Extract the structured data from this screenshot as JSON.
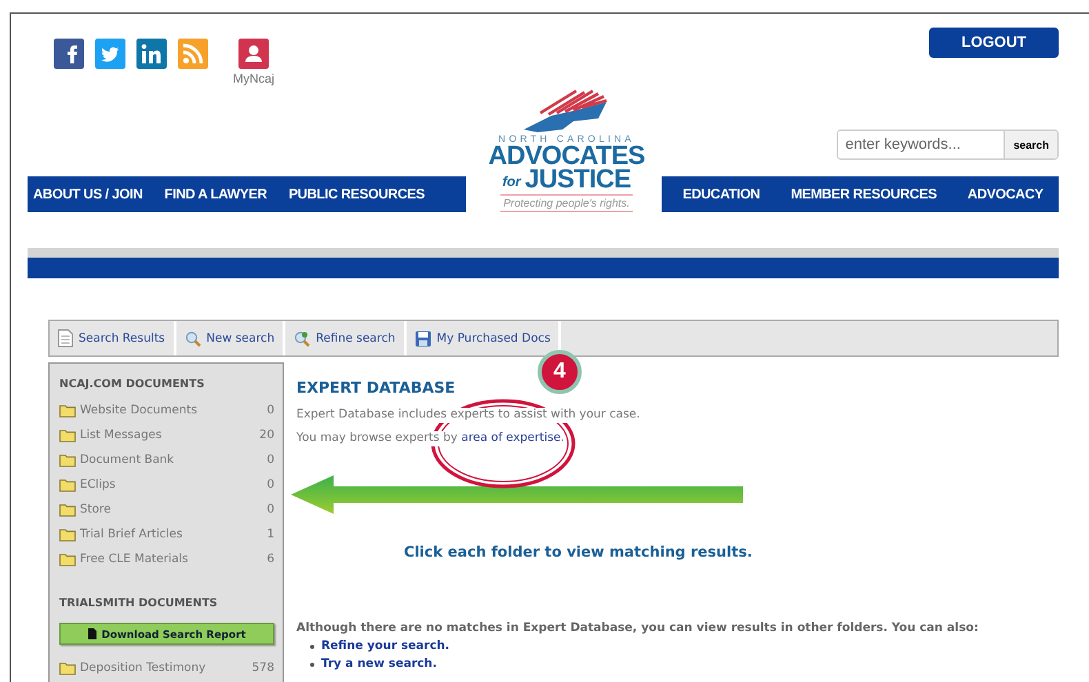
{
  "header": {
    "account_label": "MyNcaj",
    "logout": "LOGOUT",
    "search": {
      "placeholder": "enter keywords...",
      "button": "search"
    }
  },
  "logo": {
    "state": "NORTH CAROLINA",
    "line1": "ADVOCATES",
    "small": "for",
    "line2": "JUSTICE",
    "tagline": "Protecting people's rights."
  },
  "nav_left": [
    "ABOUT US / JOIN",
    "FIND A LAWYER",
    "PUBLIC RESOURCES"
  ],
  "nav_right": [
    "EDUCATION",
    "MEMBER RESOURCES",
    "ADVOCACY"
  ],
  "toolbar": [
    {
      "kind": "page",
      "label": "Search Results"
    },
    {
      "kind": "magnifier",
      "label": "New search"
    },
    {
      "kind": "refine",
      "label": "Refine search"
    },
    {
      "kind": "disk",
      "label": "My Purchased Docs"
    }
  ],
  "sidebar": {
    "sections": [
      {
        "title": "NCAJ.COM DOCUMENTS",
        "items": [
          {
            "name": "Website Documents",
            "count": "0"
          },
          {
            "name": "List Messages",
            "count": "20"
          },
          {
            "name": "Document Bank",
            "count": "0"
          },
          {
            "name": "EClips",
            "count": "0"
          },
          {
            "name": "Store",
            "count": "0"
          },
          {
            "name": "Trial Brief Articles",
            "count": "1"
          },
          {
            "name": "Free CLE Materials",
            "count": "6"
          }
        ]
      },
      {
        "title": "TRIALSMITH DOCUMENTS",
        "button": "Download Search Report",
        "items": [
          {
            "name": "Deposition Testimony",
            "count": "578"
          }
        ]
      }
    ]
  },
  "main": {
    "title": "EXPERT DATABASE",
    "intro": "Expert Database includes experts to assist with your case.",
    "browse_prefix": "You may browse experts by ",
    "browse_link": "area of expertise",
    "browse_suffix": ".",
    "hint": "Click each folder to view matching results.",
    "no_matches": "Although there are no matches in Expert Database, you can view results in other folders. You can also:",
    "options": [
      "Refine your search.",
      "Try a new search."
    ],
    "badge": "4"
  }
}
